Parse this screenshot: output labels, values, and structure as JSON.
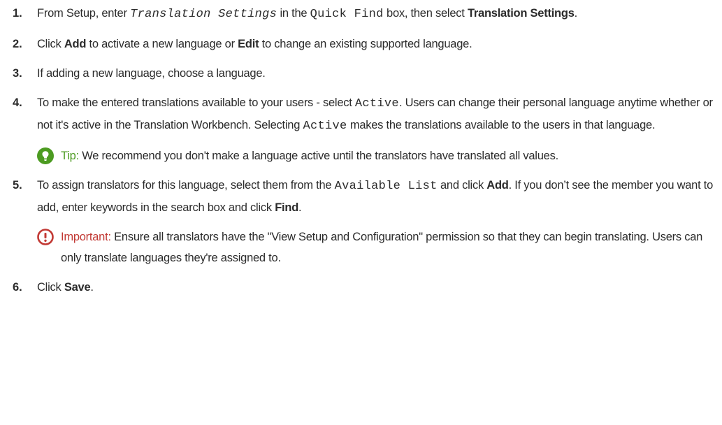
{
  "steps": [
    {
      "num": "1.",
      "p1": "From Setup, enter ",
      "code1": "Translation Settings",
      "p2": " in the ",
      "code2": "Quick Find",
      "p3": " box, then select ",
      "bold1": "Translation Settings",
      "p4": "."
    },
    {
      "num": "2.",
      "p1": "Click ",
      "bold1": "Add",
      "p2": " to activate a new language or ",
      "bold2": "Edit",
      "p3": " to change an existing supported language."
    },
    {
      "num": "3.",
      "p1": "If adding a new language, choose a language."
    },
    {
      "num": "4.",
      "p1": "To make the entered translations available to your users - select ",
      "code1": "Active",
      "p2": ". Users can change their personal language anytime whether or not it's active in the Translation Workbench. Selecting ",
      "code2": "Active",
      "p3": " makes the translations available to the users in that language."
    },
    {
      "num": "5.",
      "p1": "To assign translators for this language, select them from the ",
      "code1": "Available List",
      "p2": " and click ",
      "bold1": "Add",
      "p3": ". If you don’t see the member you want to add, enter keywords in the search box and click ",
      "bold2": "Find",
      "p4": "."
    },
    {
      "num": "6.",
      "p1": "Click ",
      "bold1": "Save",
      "p2": "."
    }
  ],
  "tip": {
    "label": "Tip:",
    "text": " We recommend you don't make a language active until the translators have translated all values.",
    "icon": "lightbulb-icon",
    "color": "#4c9b21"
  },
  "important": {
    "label": "Important:",
    "text": " Ensure all translators have the \"View Setup and Configuration\" permission so that they can begin translating. Users can only translate languages they're assigned to.",
    "icon": "exclamation-icon",
    "color": "#c23934"
  }
}
